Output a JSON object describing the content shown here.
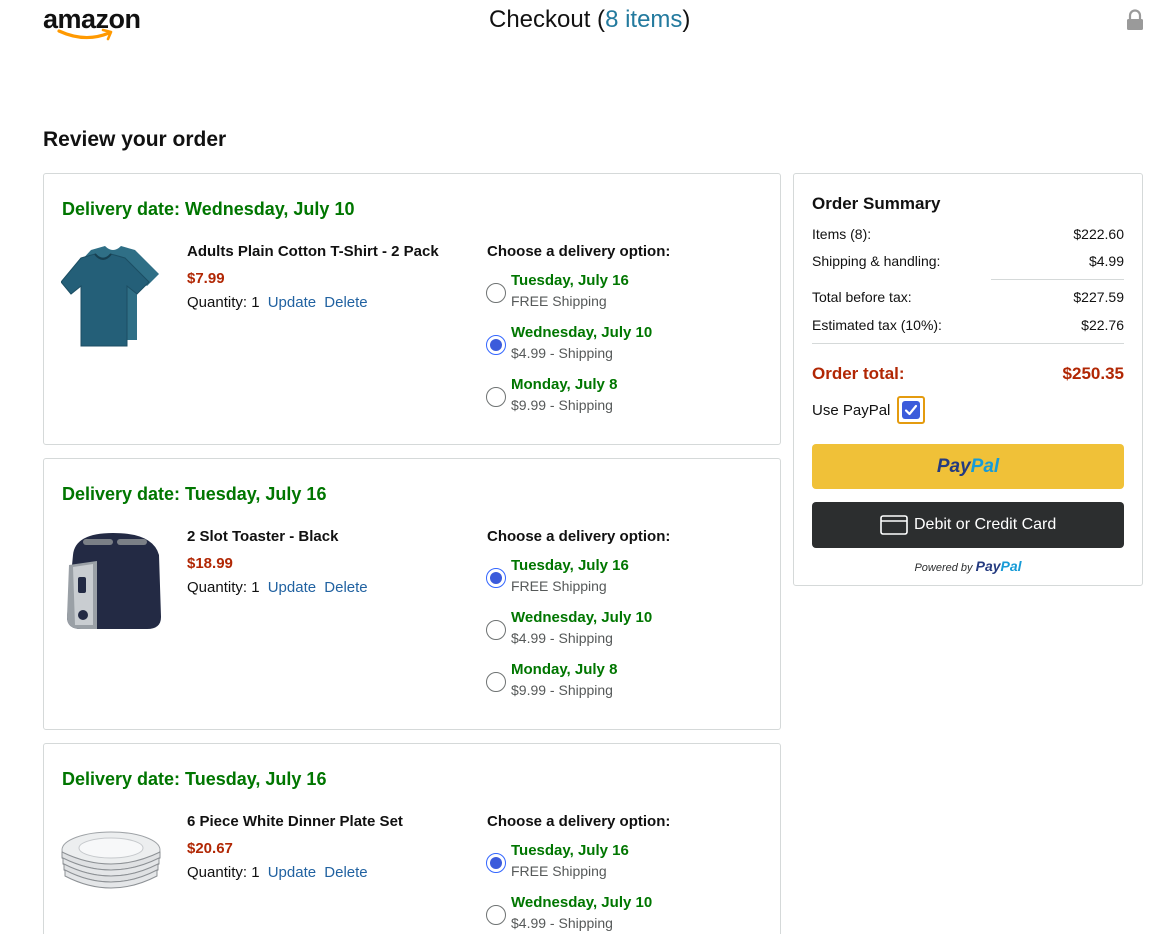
{
  "header": {
    "logo_text": "amazon",
    "checkout_prefix": "Checkout (",
    "items_link": "8 items",
    "checkout_suffix": ")"
  },
  "review_title": "Review your order",
  "orders": [
    {
      "delivery_date": "Delivery date: Wednesday, July 10",
      "product_name": "Adults Plain Cotton T-Shirt - 2 Pack",
      "price": "$7.99",
      "quantity": "Quantity: 1",
      "update": "Update",
      "delete": "Delete",
      "choose_label": "Choose a delivery option:",
      "image_icon": "tshirt-image",
      "options": [
        {
          "date": "Tuesday, July 16",
          "cost": "FREE Shipping",
          "selected": false
        },
        {
          "date": "Wednesday, July 10",
          "cost": "$4.99 - Shipping",
          "selected": true
        },
        {
          "date": "Monday, July 8",
          "cost": "$9.99 - Shipping",
          "selected": false
        }
      ]
    },
    {
      "delivery_date": "Delivery date: Tuesday, July 16",
      "product_name": "2 Slot Toaster - Black",
      "price": "$18.99",
      "quantity": "Quantity: 1",
      "update": "Update",
      "delete": "Delete",
      "choose_label": "Choose a delivery option:",
      "image_icon": "toaster-image",
      "options": [
        {
          "date": "Tuesday, July 16",
          "cost": "FREE Shipping",
          "selected": true
        },
        {
          "date": "Wednesday, July 10",
          "cost": "$4.99 - Shipping",
          "selected": false
        },
        {
          "date": "Monday, July 8",
          "cost": "$9.99 - Shipping",
          "selected": false
        }
      ]
    },
    {
      "delivery_date": "Delivery date: Tuesday, July 16",
      "product_name": "6 Piece White Dinner Plate Set",
      "price": "$20.67",
      "quantity": "Quantity: 1",
      "update": "Update",
      "delete": "Delete",
      "choose_label": "Choose a delivery option:",
      "image_icon": "plates-image",
      "options": [
        {
          "date": "Tuesday, July 16",
          "cost": "FREE Shipping",
          "selected": true
        },
        {
          "date": "Wednesday, July 10",
          "cost": "$4.99 - Shipping",
          "selected": false
        }
      ]
    }
  ],
  "summary": {
    "title": "Order Summary",
    "items_label": "Items (8):",
    "items_value": "$222.60",
    "shipping_label": "Shipping & handling:",
    "shipping_value": "$4.99",
    "before_tax_label": "Total before tax:",
    "before_tax_value": "$227.59",
    "tax_label": "Estimated tax (10%):",
    "tax_value": "$22.76",
    "total_label": "Order total:",
    "total_value": "$250.35",
    "use_paypal_label": "Use PayPal",
    "use_paypal_checked": true,
    "paypal_pay": "Pay",
    "paypal_pal": "Pal",
    "card_button": "Debit or Credit Card",
    "powered_by": "Powered by"
  },
  "colors": {
    "delivery_green": "#007600",
    "price_red": "#b12704",
    "link_blue": "#2162a1",
    "paypal_yellow": "#f0c138",
    "card_button_dark": "#2c2e2f",
    "radio_blue": "#3b5bdb"
  }
}
